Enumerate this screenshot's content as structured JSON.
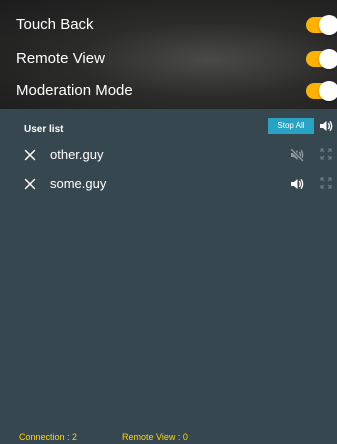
{
  "settings": [
    {
      "label": "Touch Back",
      "enabled": true
    },
    {
      "label": "Remote View",
      "enabled": true
    },
    {
      "label": "Moderation Mode",
      "enabled": true
    }
  ],
  "user_list": {
    "title": "User list",
    "stop_all_label": "Stop All",
    "users": [
      {
        "name": "other.guy",
        "audio": "muted"
      },
      {
        "name": "some.guy",
        "audio": "on"
      }
    ]
  },
  "status": {
    "connection": "Connection : 2",
    "remote_view": "Remote View : 0"
  },
  "colors": {
    "toggle_on": "#ffb300",
    "panel_bg": "#37474f",
    "button_bg": "#29a3c3",
    "status_text": "#ffd600",
    "muted_icon": "#8f9ba1",
    "expand_icon": "#6f7c83"
  },
  "icons": {
    "remove": "close-icon",
    "volume_on": "volume-on-icon",
    "volume_muted": "volume-muted-icon",
    "expand": "expand-icon"
  }
}
